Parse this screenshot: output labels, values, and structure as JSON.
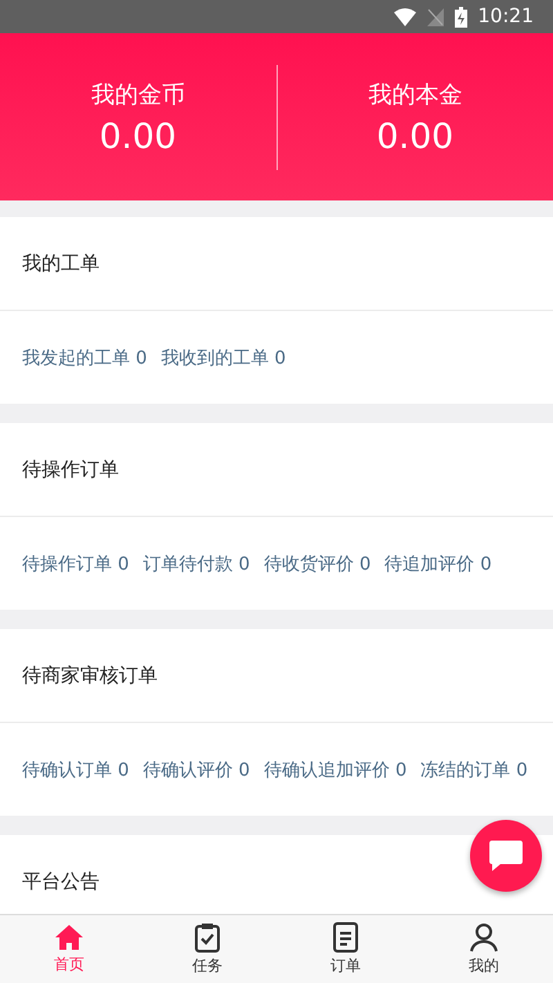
{
  "status_bar": {
    "time": "10:21"
  },
  "header": {
    "stats": [
      {
        "label": "我的金币",
        "value": "0.00"
      },
      {
        "label": "我的本金",
        "value": "0.00"
      }
    ]
  },
  "sections": [
    {
      "title": "我的工单",
      "links": [
        "我发起的工单 0",
        "我收到的工单 0"
      ]
    },
    {
      "title": "待操作订单",
      "links": [
        "待操作订单 0",
        "订单待付款 0",
        "待收货评价 0",
        "待追加评价 0"
      ]
    },
    {
      "title": "待商家审核订单",
      "links": [
        "待确认订单 0",
        "待确认评价 0",
        "待确认追加评价 0",
        "冻结的订单 0"
      ]
    },
    {
      "title": "平台公告"
    }
  ],
  "tabs": [
    {
      "label": "首页",
      "kind": "home",
      "selected": true
    },
    {
      "label": "任务",
      "kind": "task",
      "selected": false
    },
    {
      "label": "订单",
      "kind": "order",
      "selected": false
    },
    {
      "label": "我的",
      "kind": "me",
      "selected": false
    }
  ]
}
